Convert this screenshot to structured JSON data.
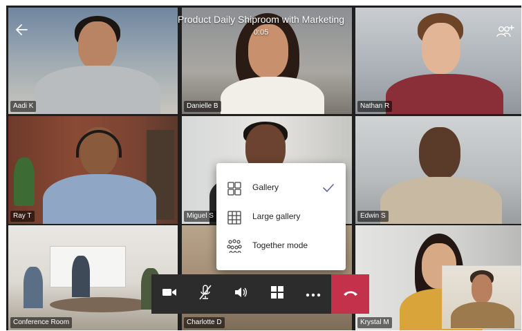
{
  "header": {
    "title": "Product Daily Shiproom with Marketing",
    "time": "0:05"
  },
  "participants": [
    {
      "name": "Aadi K"
    },
    {
      "name": "Danielle B"
    },
    {
      "name": "Nathan R"
    },
    {
      "name": "Ray T"
    },
    {
      "name": "Miguel S"
    },
    {
      "name": "Edwin S"
    },
    {
      "name": "Conference Room"
    },
    {
      "name": "Charlotte D"
    },
    {
      "name": "Krystal M"
    }
  ],
  "view_menu": {
    "items": [
      {
        "label": "Gallery",
        "icon": "gallery-icon",
        "selected": true
      },
      {
        "label": "Large gallery",
        "icon": "large-gallery-icon",
        "selected": false
      },
      {
        "label": "Together mode",
        "icon": "together-mode-icon",
        "selected": false
      }
    ]
  },
  "toolbar": {
    "buttons": [
      "camera-icon",
      "mic-muted-icon",
      "speaker-icon",
      "layout-icon",
      "more-icon",
      "hangup-icon"
    ]
  },
  "colors": {
    "hangup": "#c4314b",
    "accent": "#6264a7",
    "toolbar": "#2d2c2c"
  }
}
